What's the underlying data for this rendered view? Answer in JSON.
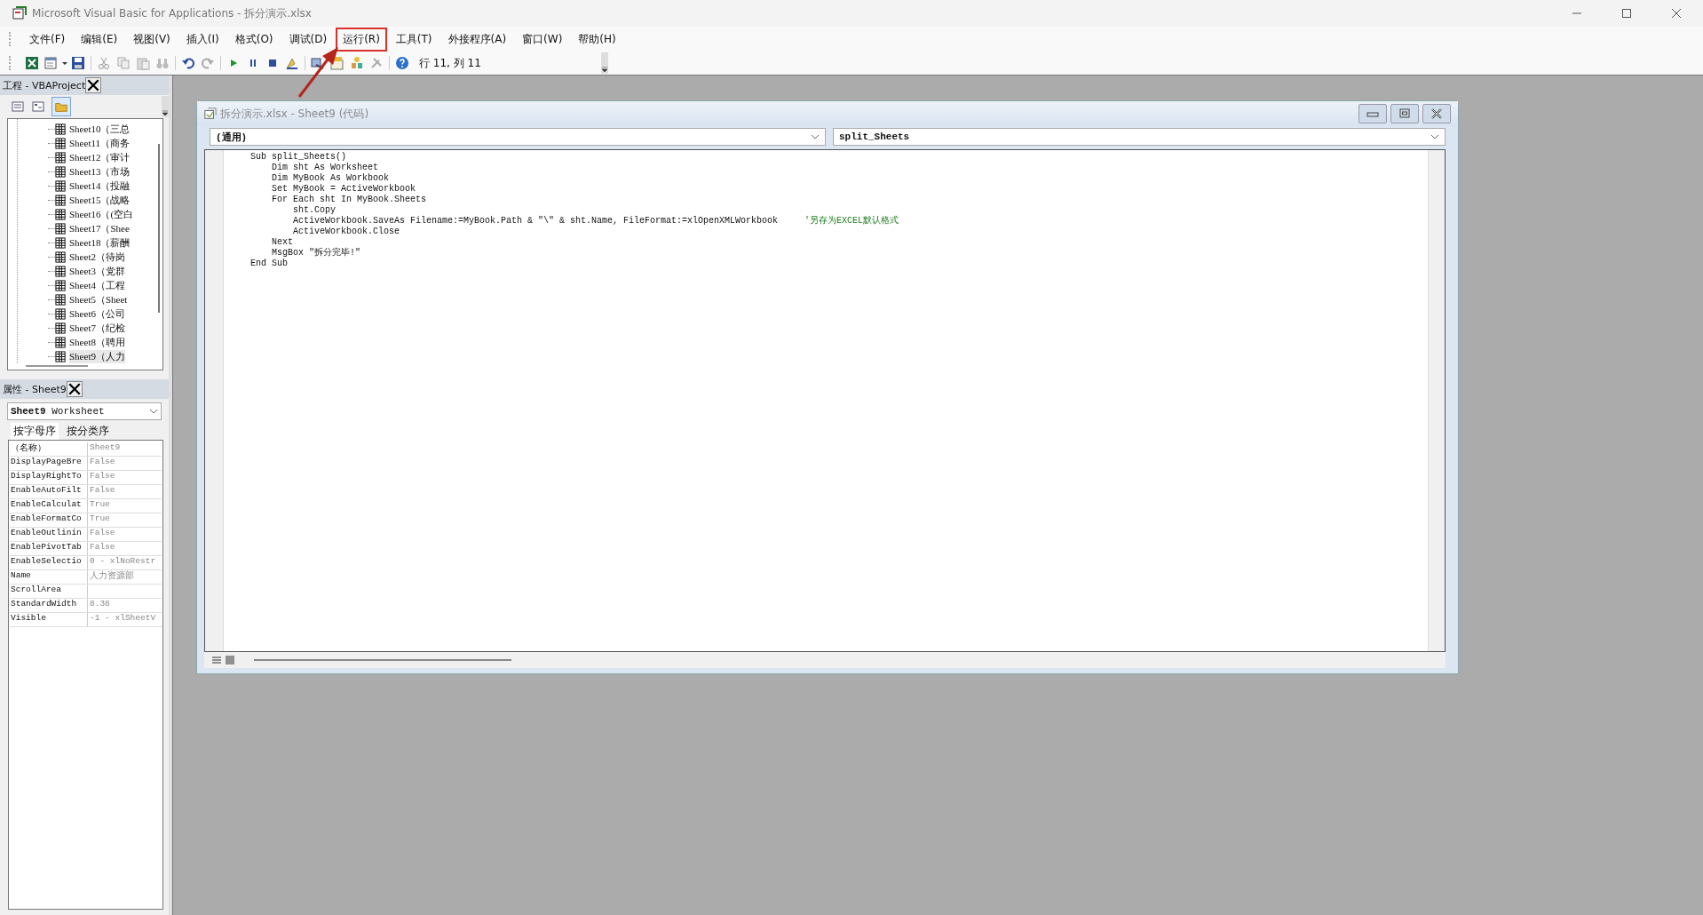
{
  "window": {
    "title": "Microsoft Visual Basic for Applications - 拆分演示.xlsx"
  },
  "menu": [
    {
      "label": "文件(F)",
      "highlighted": false
    },
    {
      "label": "编辑(E)",
      "highlighted": false
    },
    {
      "label": "视图(V)",
      "highlighted": false
    },
    {
      "label": "插入(I)",
      "highlighted": false
    },
    {
      "label": "格式(O)",
      "highlighted": false
    },
    {
      "label": "调试(D)",
      "highlighted": false
    },
    {
      "label": "运行(R)",
      "highlighted": true
    },
    {
      "label": "工具(T)",
      "highlighted": false
    },
    {
      "label": "外接程序(A)",
      "highlighted": false
    },
    {
      "label": "窗口(W)",
      "highlighted": false
    },
    {
      "label": "帮助(H)",
      "highlighted": false
    }
  ],
  "toolbar": {
    "position": "行 11, 列 11"
  },
  "project_panel": {
    "title": "工程 - VBAProject",
    "items": [
      {
        "label": "Sheet10（三总",
        "selected": false
      },
      {
        "label": "Sheet11（商务",
        "selected": false
      },
      {
        "label": "Sheet12（审计",
        "selected": false
      },
      {
        "label": "Sheet13（市场",
        "selected": false
      },
      {
        "label": "Sheet14（投融",
        "selected": false
      },
      {
        "label": "Sheet15（战略",
        "selected": false
      },
      {
        "label": "Sheet16（(空白",
        "selected": false
      },
      {
        "label": "Sheet17（Shee",
        "selected": false
      },
      {
        "label": "Sheet18（薪酬",
        "selected": false
      },
      {
        "label": "Sheet2（待岗",
        "selected": false
      },
      {
        "label": "Sheet3（党群",
        "selected": false
      },
      {
        "label": "Sheet4（工程",
        "selected": false
      },
      {
        "label": "Sheet5（Sheet",
        "selected": false
      },
      {
        "label": "Sheet6（公司",
        "selected": false
      },
      {
        "label": "Sheet7（纪检",
        "selected": false
      },
      {
        "label": "Sheet8（聘用",
        "selected": false
      },
      {
        "label": "Sheet9（人力",
        "selected": true
      }
    ]
  },
  "properties_panel": {
    "title": "属性 - Sheet9",
    "object_name": "Sheet9",
    "object_type": "Worksheet",
    "tabs": [
      {
        "label": "按字母序",
        "selected": true
      },
      {
        "label": "按分类序",
        "selected": false
      }
    ],
    "rows": [
      {
        "name": "（名称）",
        "value": "Sheet9"
      },
      {
        "name": "DisplayPageBre",
        "value": "False"
      },
      {
        "name": "DisplayRightTo",
        "value": "False"
      },
      {
        "name": "EnableAutoFilt",
        "value": "False"
      },
      {
        "name": "EnableCalculat",
        "value": "True"
      },
      {
        "name": "EnableFormatCo",
        "value": "True"
      },
      {
        "name": "EnableOutlinin",
        "value": "False"
      },
      {
        "name": "EnablePivotTab",
        "value": "False"
      },
      {
        "name": "EnableSelectio",
        "value": "0 - xlNoRestr"
      },
      {
        "name": "Name",
        "value": "人力资源部"
      },
      {
        "name": "ScrollArea"
      },
      {
        "name": "StandardWidth",
        "value": "8.38"
      },
      {
        "name": "Visible",
        "value": "-1 - xlSheetV"
      }
    ]
  },
  "code_window": {
    "title": "拆分演示.xlsx - Sheet9 (代码)",
    "object_box": "(通用)",
    "procedure_box": "split_Sheets",
    "lines": [
      {
        "code": "Sub split_Sheets()"
      },
      {
        "code": "    Dim sht As Worksheet"
      },
      {
        "code": "    Dim MyBook As Workbook"
      },
      {
        "code": "    Set MyBook = ActiveWorkbook"
      },
      {
        "code": "    For Each sht In MyBook.Sheets"
      },
      {
        "code": "        sht.Copy"
      },
      {
        "code": "        ActiveWorkbook.SaveAs Filename:=MyBook.Path & \"\\\" & sht.Name, FileFormat:=xlOpenXMLWorkbook",
        "comment": "'另存为EXCEL默认格式"
      },
      {
        "code": "        ActiveWorkbook.Close"
      },
      {
        "code": "    Next"
      },
      {
        "code": "    MsgBox \"拆分完毕!\""
      },
      {
        "code": "End Sub"
      }
    ]
  }
}
